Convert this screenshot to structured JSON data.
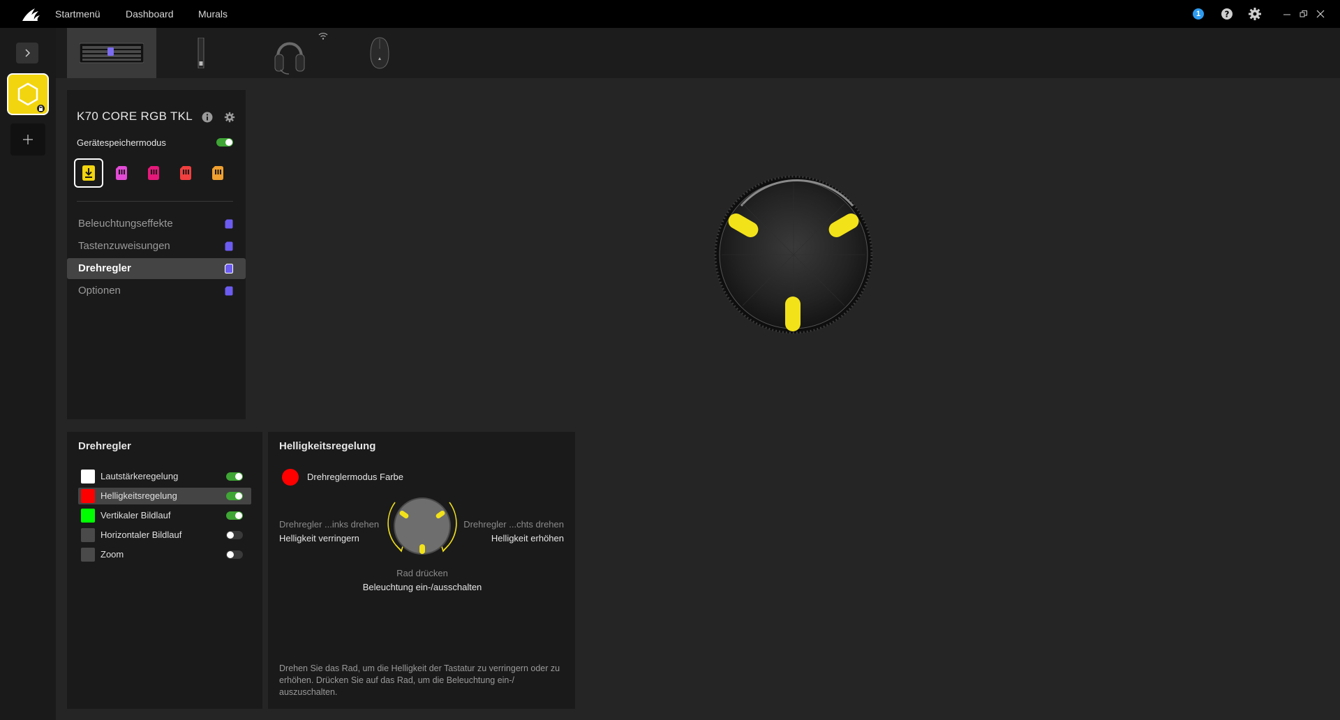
{
  "topbar": {
    "nav": [
      "Startmenü",
      "Dashboard",
      "Murals"
    ],
    "notification_count": "1"
  },
  "device_panel": {
    "device_name": "K70 CORE RGB TKL",
    "memory_mode_label": "Gerätespeichermodus",
    "memory_mode_on": true,
    "slot_colors": [
      "#f2d50f",
      "#e34ad6",
      "#e6187a",
      "#f23f3f",
      "#f0a030"
    ],
    "menu": [
      {
        "label": "Beleuchtungseffekte",
        "active": false
      },
      {
        "label": "Tastenzuweisungen",
        "active": false
      },
      {
        "label": "Drehregler",
        "active": true
      },
      {
        "label": "Optionen",
        "active": false
      }
    ]
  },
  "dial_list": {
    "title": "Drehregler",
    "items": [
      {
        "label": "Lautstärkeregelung",
        "color": "#ffffff",
        "enabled": true,
        "active": false
      },
      {
        "label": "Helligkeitsregelung",
        "color": "#ff0000",
        "enabled": true,
        "active": true
      },
      {
        "label": "Vertikaler Bildlauf",
        "color": "#00ff00",
        "enabled": true,
        "active": false
      },
      {
        "label": "Horizontaler Bildlauf",
        "color": "#4a4a4a",
        "enabled": false,
        "active": false
      },
      {
        "label": "Zoom",
        "color": "#4a4a4a",
        "enabled": false,
        "active": false
      }
    ]
  },
  "brightness": {
    "title": "Helligkeitsregelung",
    "mode_label": "Drehreglermodus Farbe",
    "left_hint": "Drehregler ...inks drehen",
    "left_action": "Helligkeit verringern",
    "right_hint": "Drehregler ...chts drehen",
    "right_action": "Helligkeit erhöhen",
    "press_hint": "Rad drücken",
    "press_action": "Beleuchtung ein-/ausschalten",
    "description": "Drehen Sie das Rad, um die Helligkeit der Tastatur zu verringern oder zu erhöhen. Drücken Sie auf das Rad, um die Beleuchtung ein-/ auszuschalten."
  }
}
